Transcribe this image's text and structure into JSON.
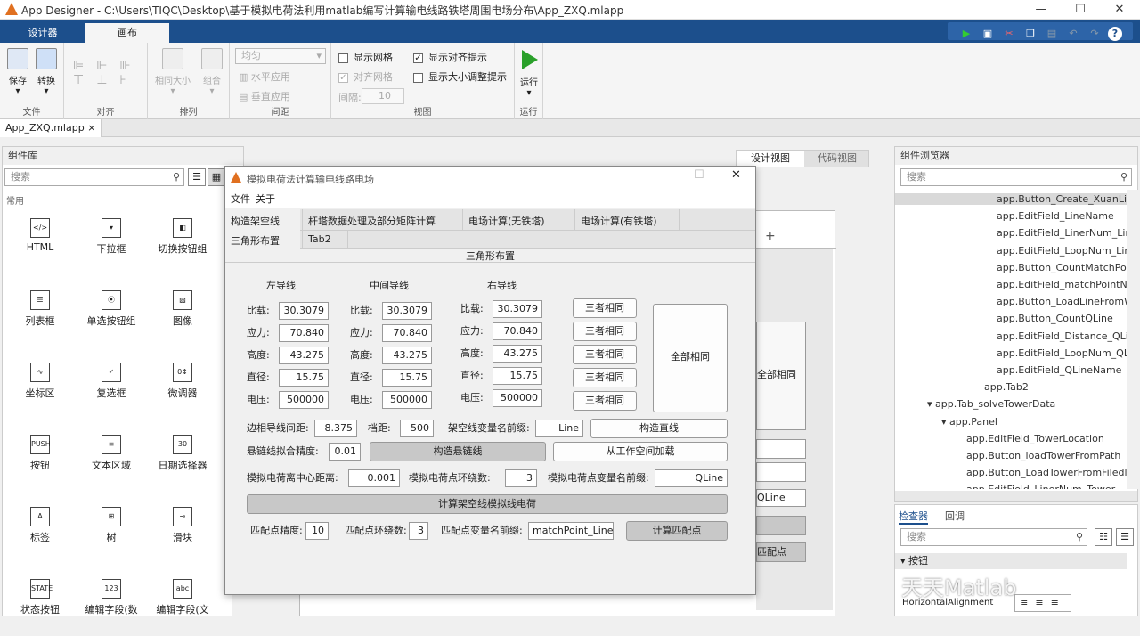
{
  "window": {
    "title": "App Designer - C:\\Users\\TIQC\\Desktop\\基于模拟电荷法利用matlab编写计算输电线路铁塔周围电场分布\\App_ZXQ.mlapp",
    "minimize": "—",
    "maximize": "☐",
    "close": "✕"
  },
  "ribbon_tabs": [
    "设计器",
    "画布"
  ],
  "ribbon": {
    "save": "保存",
    "convert": "转换",
    "file_group": "文件",
    "align_group": "对齐",
    "same_size": "相同大小",
    "group": "组合",
    "arrange_group": "排列",
    "spacing_select": "均匀",
    "h_apply": "水平应用",
    "v_apply": "垂直应用",
    "spacing_group": "间距",
    "show_grid": "显示网格",
    "snap_grid": "对齐网格",
    "interval_label": "间隔:",
    "interval_value": "10",
    "show_align_hints": "显示对齐提示",
    "show_resize_hints": "显示大小调整提示",
    "view_group": "视图",
    "run": "运行",
    "run_group": "运行"
  },
  "doc_tab": {
    "label": "App_ZXQ.mlapp",
    "close": "×"
  },
  "library": {
    "title": "组件库",
    "search_placeholder": "搜索",
    "section": "常用",
    "items": [
      "HTML",
      "下拉框",
      "切换按钮组",
      "列表框",
      "单选按钮组",
      "图像",
      "坐标区",
      "复选框",
      "微调器",
      "按钮",
      "文本区域",
      "日期选择器",
      "标签",
      "树",
      "滑块",
      "状态按钮",
      "编辑字段(数",
      "编辑字段(文"
    ],
    "icons": [
      "</>",
      "▾",
      "◧",
      "☰",
      "⦿",
      "▨",
      "∿",
      "✓",
      "0↕",
      "PUSH",
      "≡",
      "30",
      "A",
      "⊞",
      "⊸",
      "STATE",
      "123",
      "abc"
    ]
  },
  "view_toggle": {
    "design": "设计视图",
    "code": "代码视图"
  },
  "app": {
    "title": "模拟电荷法计算输电线路电场",
    "menu": [
      "文件",
      "关于"
    ],
    "tabs_row1": [
      "构造架空线",
      "杆塔数据处理及部分矩阵计算",
      "电场计算(无铁塔)",
      "电场计算(有铁塔)"
    ],
    "tabs_row2": [
      "三角形布置",
      "Tab2"
    ],
    "panel_title": "三角形布置",
    "col_headers": [
      "左导线",
      "中间导线",
      "右导线"
    ],
    "row_labels": [
      "比载:",
      "应力:",
      "高度:",
      "直径:",
      "电压:"
    ],
    "left": [
      "30.3079",
      "70.840",
      "43.275",
      "15.75",
      "500000"
    ],
    "mid": [
      "30.3079",
      "70.840",
      "43.275",
      "15.75",
      "500000"
    ],
    "right": [
      "30.3079",
      "70.840",
      "43.275",
      "15.75",
      "500000"
    ],
    "same_three": "三者相同",
    "all_same": "全部相同",
    "edge_dist_label": "边相导线间距:",
    "edge_dist": "8.375",
    "span_label": "档距:",
    "span": "500",
    "prefix_label": "架空线变量名前缀:",
    "prefix": "Line",
    "build_line": "构造直线",
    "catenary_label": "悬链线拟合精度:",
    "catenary": "0.01",
    "build_catenary": "构造悬链线",
    "load_ws": "从工作空间加载",
    "center_dist_label": "模拟电荷离中心距离:",
    "center_dist": "0.001",
    "ring_label": "模拟电荷点环绕数:",
    "ring": "3",
    "charge_prefix_label": "模拟电荷点变量名前缀:",
    "charge_prefix": "QLine",
    "compute_charge": "计算架空线模拟线电荷",
    "match_prec_label": "匹配点精度:",
    "match_prec": "10",
    "match_ring_label": "匹配点环绕数:",
    "match_ring": "3",
    "match_prefix_label": "匹配点变量名前缀:",
    "match_prefix": "matchPoint_Line",
    "compute_match": "计算匹配点"
  },
  "behind": {
    "all_same": "全部相同",
    "qline": "QLine",
    "match": "匹配点",
    "plus": "+"
  },
  "browser": {
    "title": "组件浏览器",
    "search_placeholder": "搜索",
    "items": [
      "app.Button_Create_XuanLian",
      "app.EditField_LineName",
      "app.EditField_LinerNum_Line",
      "app.EditField_LoopNum_Line",
      "app.Button_CountMatchPoint",
      "app.EditField_matchPointNam",
      "app.Button_LoadLineFromWo",
      "app.Button_CountQLine",
      "app.EditField_Distance_QLin",
      "app.EditField_LoopNum_QLin",
      "app.EditField_QLineName",
      "app.Tab2",
      "app.Tab_solveTowerData",
      "app.Panel",
      "app.EditField_TowerLocation",
      "app.Button_loadTowerFromPath",
      "app.Button_LoadTowerFromFiledlg",
      "app.EditField_LinerNum_Tower"
    ]
  },
  "inspector": {
    "tabs": [
      "检查器",
      "回调"
    ],
    "search_placeholder": "搜索",
    "section": "按钮",
    "prop": "HorizontalAlignment"
  },
  "watermark": "天天Matlab",
  "colors": {
    "ribbon_blue": "#1c4f8c",
    "run_green": "#2aa02a",
    "selected": "#d9d9d9"
  }
}
